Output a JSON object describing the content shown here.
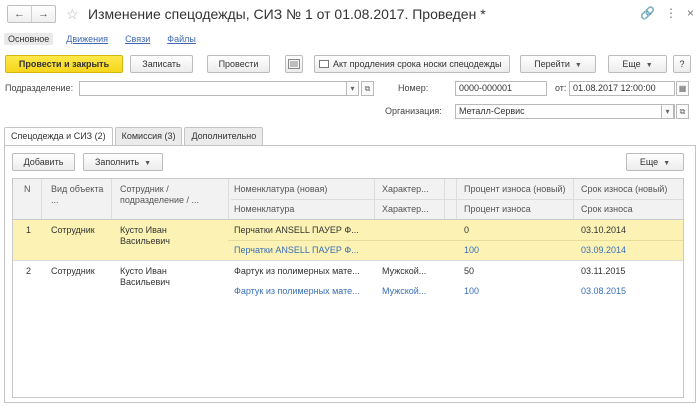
{
  "window": {
    "title": "Изменение спецодежды, СИЗ № 1 от 01.08.2017. Проведен *",
    "nav_back": "←",
    "nav_forward": "→",
    "star": "☆",
    "link_icon": "🔗",
    "more_icon": "⋮",
    "close_icon": "×"
  },
  "sections": [
    "Основное",
    "Движения",
    "Связи",
    "Файлы"
  ],
  "toolbar": {
    "post_close": "Провести и закрыть",
    "save": "Записать",
    "post": "Провести",
    "act": "Акт продления срока носки спецодежды",
    "goto": "Перейти",
    "more": "Еще",
    "help": "?"
  },
  "form": {
    "division_label": "Подразделение:",
    "division_value": "",
    "number_label": "Номер:",
    "number_value": "0000-000001",
    "from_label": "от:",
    "from_value": "01.08.2017 12:00:00",
    "org_label": "Организация:",
    "org_value": "Металл-Сервис"
  },
  "tabs": [
    "Спецодежда и СИЗ (2)",
    "Комиссия (3)",
    "Дополнительно"
  ],
  "table_toolbar": {
    "add": "Добавить",
    "fill": "Заполнить",
    "more": "Еще"
  },
  "table": {
    "headers_top": [
      "N",
      "Вид объекта ...",
      "Сотрудник / подразделение / ...",
      "Номенклатура (новая)",
      "Характер...",
      "Процент износа (новый)",
      "Срок износа (новый)"
    ],
    "headers_bottom": [
      "",
      "",
      "",
      "Номенклатура",
      "Характер...",
      "Процент износа",
      "Срок износа"
    ],
    "rows": [
      {
        "n": "1",
        "kind": "Сотрудник",
        "employee": "Кусто Иван Васильевич",
        "nomen_new": "Перчатки ANSELL  ПАУЕР Ф...",
        "nomen": "Перчатки ANSELL  ПАУЕР Ф...",
        "char_new": "",
        "char": "",
        "pct_new": "0",
        "pct": "100",
        "date_new": "03.10.2014",
        "date": "03.09.2014"
      },
      {
        "n": "2",
        "kind": "Сотрудник",
        "employee": "Кусто Иван Васильевич",
        "nomen_new": "Фартук из полимерных мате...",
        "nomen": "Фартук из полимерных мате...",
        "char_new": "Мужской...",
        "char": "Мужской...",
        "pct_new": "50",
        "pct": "100",
        "date_new": "03.11.2015",
        "date": "03.08.2015"
      }
    ]
  }
}
